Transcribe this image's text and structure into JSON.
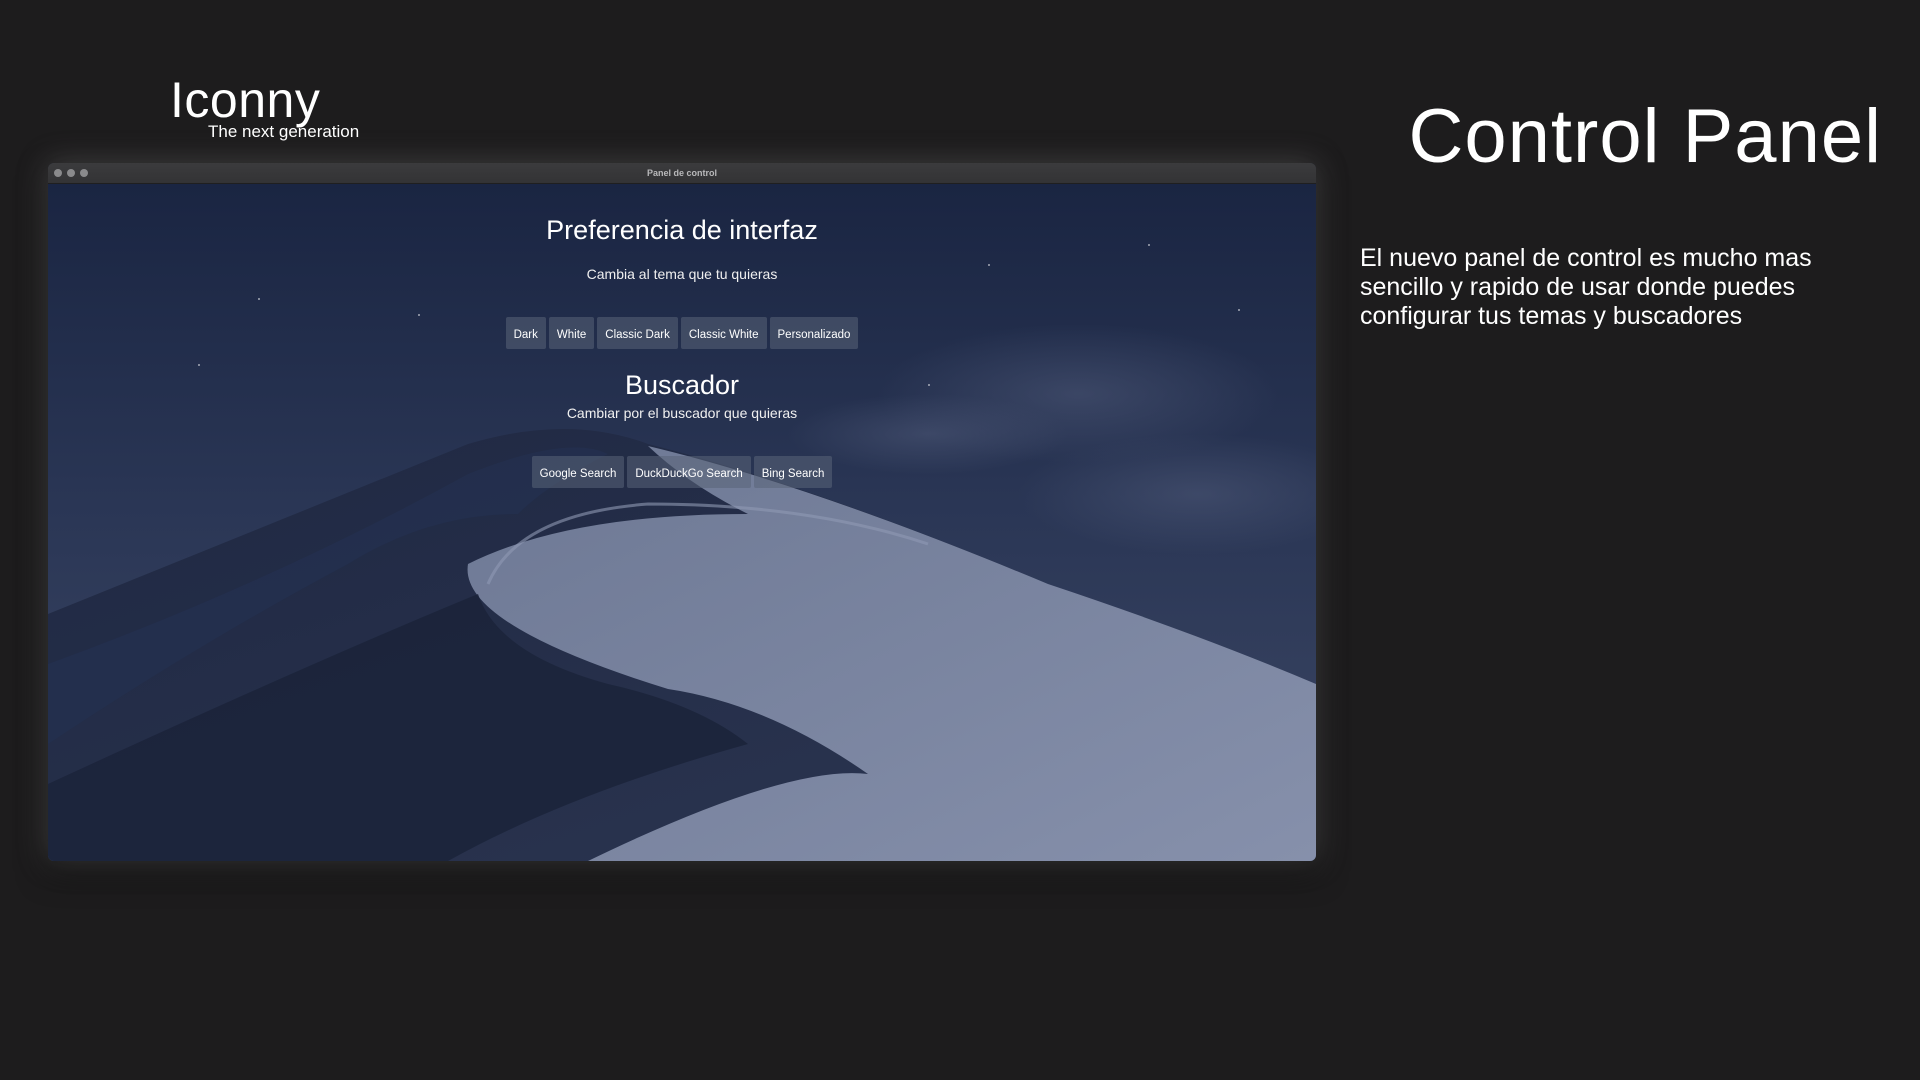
{
  "brand": {
    "name": "Iconny",
    "tagline": "The next generation"
  },
  "headline": "Control Panel",
  "description": "El nuevo panel de control es mucho mas sencillo y rapido de usar donde puedes configurar tus temas y buscadores",
  "window": {
    "title": "Panel de control",
    "traffic_lights": [
      "close",
      "minimize",
      "zoom"
    ]
  },
  "interface_section": {
    "title": "Preferencia de interfaz",
    "subtitle": "Cambia al tema que tu quieras",
    "buttons": [
      "Dark",
      "White",
      "Classic Dark",
      "Classic White",
      "Personalizado"
    ]
  },
  "search_section": {
    "title": "Buscador",
    "subtitle": "Cambiar por el buscador que quieras",
    "buttons": [
      "Google Search",
      "DuckDuckGo Search",
      "Bing Search"
    ]
  },
  "colors": {
    "page_background": "#1d1c1d",
    "wallpaper_sky": "#26324f",
    "button_background": "#5a6478"
  }
}
